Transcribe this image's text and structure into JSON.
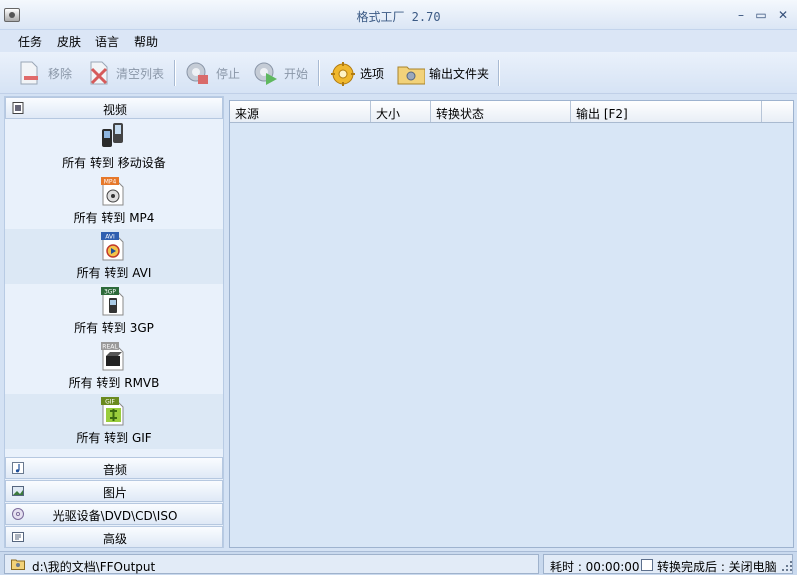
{
  "window": {
    "title": "格式工厂 2.70"
  },
  "menu": [
    "任务",
    "皮肤",
    "语言",
    "帮助"
  ],
  "toolbar": {
    "remove": "移除",
    "clear_list": "清空列表",
    "stop": "停止",
    "start": "开始",
    "options": "选项",
    "output_folder": "输出文件夹"
  },
  "sidebar": {
    "video": {
      "label": "视频",
      "items": [
        {
          "label": "所有 转到 移动设备",
          "badge": ""
        },
        {
          "label": "所有 转到 MP4",
          "badge": "MP4"
        },
        {
          "label": "所有 转到 AVI",
          "badge": "AVI"
        },
        {
          "label": "所有 转到 3GP",
          "badge": "3GP"
        },
        {
          "label": "所有 转到 RMVB",
          "badge": "REAL"
        },
        {
          "label": "所有 转到 GIF",
          "badge": "GIF"
        }
      ]
    },
    "audio": {
      "label": "音频"
    },
    "picture": {
      "label": "图片"
    },
    "rom": {
      "label": "光驱设备\\DVD\\CD\\ISO"
    },
    "advanced": {
      "label": "高级"
    }
  },
  "task_list": {
    "columns": [
      "来源",
      "大小",
      "转换状态",
      "输出 [F2]"
    ],
    "rows": []
  },
  "status": {
    "output_path": "d:\\我的文档\\FFOutput",
    "elapsed": "耗时 : 00:00:00",
    "after_done": "转换完成后 : 关闭电脑"
  },
  "colors": {
    "panel_bg": "#d8e6f6",
    "title_text": "#3b5a85",
    "highlight_band": "#dce8f5"
  }
}
